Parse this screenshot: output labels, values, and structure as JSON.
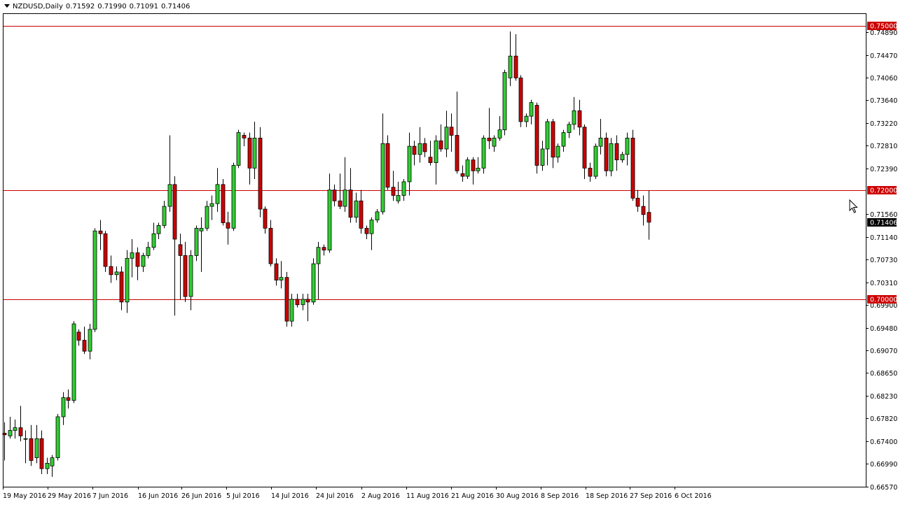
{
  "header": {
    "symbol": "NZDUSD,Daily",
    "open": "0.71592",
    "high": "0.71990",
    "low": "0.71091",
    "close": "0.71406"
  },
  "chart_data": {
    "type": "candlestick",
    "symbol": "NZDUSD",
    "timeframe": "Daily",
    "ylim": [
      0.6657,
      0.7522
    ],
    "y_ticks": [
      "0.74890",
      "0.74470",
      "0.74060",
      "0.73640",
      "0.73220",
      "0.72810",
      "0.72390",
      "0.71560",
      "0.71140",
      "0.70730",
      "0.70310",
      "0.69900",
      "0.69480",
      "0.69070",
      "0.68650",
      "0.68230",
      "0.67820",
      "0.67400",
      "0.66990",
      "0.66570"
    ],
    "x_labels": [
      "19 May 2016",
      "29 May 2016",
      "7 Jun 2016",
      "16 Jun 2016",
      "26 Jun 2016",
      "5 Jul 2016",
      "14 Jul 2016",
      "24 Jul 2016",
      "2 Aug 2016",
      "11 Aug 2016",
      "21 Aug 2016",
      "30 Aug 2016",
      "8 Sep 2016",
      "18 Sep 2016",
      "27 Sep 2016",
      "6 Oct 2016"
    ],
    "levels": [
      {
        "value": 0.75,
        "label": "0.75000"
      },
      {
        "value": 0.72,
        "label": "0.72000"
      },
      {
        "value": 0.7,
        "label": "0.70000"
      }
    ],
    "current_price": {
      "value": 0.71406,
      "label": "0.71406"
    },
    "colors": {
      "bull": "#32cd32",
      "bear": "#cc0000",
      "level": "#cc0000",
      "wick": "#000000"
    },
    "candles": [
      {
        "o": 0.6755,
        "h": 0.6775,
        "l": 0.6705,
        "c": 0.6752
      },
      {
        "o": 0.675,
        "h": 0.6785,
        "l": 0.6745,
        "c": 0.676
      },
      {
        "o": 0.676,
        "h": 0.678,
        "l": 0.6745,
        "c": 0.6765
      },
      {
        "o": 0.6765,
        "h": 0.6805,
        "l": 0.674,
        "c": 0.675
      },
      {
        "o": 0.6745,
        "h": 0.676,
        "l": 0.67,
        "c": 0.6745
      },
      {
        "o": 0.6745,
        "h": 0.677,
        "l": 0.6695,
        "c": 0.6705
      },
      {
        "o": 0.671,
        "h": 0.677,
        "l": 0.67,
        "c": 0.6745
      },
      {
        "o": 0.6745,
        "h": 0.676,
        "l": 0.668,
        "c": 0.669
      },
      {
        "o": 0.669,
        "h": 0.671,
        "l": 0.668,
        "c": 0.67
      },
      {
        "o": 0.6695,
        "h": 0.6715,
        "l": 0.6675,
        "c": 0.671
      },
      {
        "o": 0.671,
        "h": 0.679,
        "l": 0.6705,
        "c": 0.6785
      },
      {
        "o": 0.6785,
        "h": 0.683,
        "l": 0.677,
        "c": 0.682
      },
      {
        "o": 0.682,
        "h": 0.6835,
        "l": 0.68,
        "c": 0.6815
      },
      {
        "o": 0.6815,
        "h": 0.696,
        "l": 0.681,
        "c": 0.6955
      },
      {
        "o": 0.694,
        "h": 0.6945,
        "l": 0.6915,
        "c": 0.6925
      },
      {
        "o": 0.6925,
        "h": 0.695,
        "l": 0.69,
        "c": 0.6905
      },
      {
        "o": 0.6905,
        "h": 0.6955,
        "l": 0.689,
        "c": 0.6945
      },
      {
        "o": 0.6945,
        "h": 0.713,
        "l": 0.694,
        "c": 0.7125
      },
      {
        "o": 0.7125,
        "h": 0.7145,
        "l": 0.709,
        "c": 0.712
      },
      {
        "o": 0.712,
        "h": 0.7125,
        "l": 0.705,
        "c": 0.706
      },
      {
        "o": 0.706,
        "h": 0.708,
        "l": 0.703,
        "c": 0.7045
      },
      {
        "o": 0.7045,
        "h": 0.706,
        "l": 0.7035,
        "c": 0.705
      },
      {
        "o": 0.705,
        "h": 0.706,
        "l": 0.698,
        "c": 0.6995
      },
      {
        "o": 0.6995,
        "h": 0.709,
        "l": 0.6975,
        "c": 0.7075
      },
      {
        "o": 0.7075,
        "h": 0.711,
        "l": 0.704,
        "c": 0.7085
      },
      {
        "o": 0.7085,
        "h": 0.7095,
        "l": 0.7035,
        "c": 0.706
      },
      {
        "o": 0.706,
        "h": 0.7085,
        "l": 0.705,
        "c": 0.708
      },
      {
        "o": 0.708,
        "h": 0.7105,
        "l": 0.7075,
        "c": 0.7095
      },
      {
        "o": 0.7095,
        "h": 0.714,
        "l": 0.709,
        "c": 0.712
      },
      {
        "o": 0.712,
        "h": 0.714,
        "l": 0.711,
        "c": 0.7135
      },
      {
        "o": 0.7135,
        "h": 0.718,
        "l": 0.713,
        "c": 0.717
      },
      {
        "o": 0.717,
        "h": 0.73,
        "l": 0.716,
        "c": 0.721
      },
      {
        "o": 0.721,
        "h": 0.7225,
        "l": 0.697,
        "c": 0.711
      },
      {
        "o": 0.71,
        "h": 0.712,
        "l": 0.7,
        "c": 0.708
      },
      {
        "o": 0.708,
        "h": 0.7105,
        "l": 0.6995,
        "c": 0.7005
      },
      {
        "o": 0.7005,
        "h": 0.709,
        "l": 0.698,
        "c": 0.708
      },
      {
        "o": 0.708,
        "h": 0.7135,
        "l": 0.707,
        "c": 0.713
      },
      {
        "o": 0.7125,
        "h": 0.715,
        "l": 0.705,
        "c": 0.713
      },
      {
        "o": 0.713,
        "h": 0.718,
        "l": 0.7125,
        "c": 0.717
      },
      {
        "o": 0.717,
        "h": 0.719,
        "l": 0.7145,
        "c": 0.7175
      },
      {
        "o": 0.7175,
        "h": 0.724,
        "l": 0.716,
        "c": 0.721
      },
      {
        "o": 0.721,
        "h": 0.722,
        "l": 0.7135,
        "c": 0.714
      },
      {
        "o": 0.714,
        "h": 0.716,
        "l": 0.71,
        "c": 0.713
      },
      {
        "o": 0.713,
        "h": 0.725,
        "l": 0.7125,
        "c": 0.7245
      },
      {
        "o": 0.7245,
        "h": 0.731,
        "l": 0.724,
        "c": 0.7305
      },
      {
        "o": 0.73,
        "h": 0.7305,
        "l": 0.728,
        "c": 0.7295
      },
      {
        "o": 0.7295,
        "h": 0.7305,
        "l": 0.721,
        "c": 0.724
      },
      {
        "o": 0.724,
        "h": 0.7325,
        "l": 0.722,
        "c": 0.7295
      },
      {
        "o": 0.7295,
        "h": 0.7315,
        "l": 0.715,
        "c": 0.7165
      },
      {
        "o": 0.7165,
        "h": 0.717,
        "l": 0.712,
        "c": 0.713
      },
      {
        "o": 0.713,
        "h": 0.7145,
        "l": 0.706,
        "c": 0.7065
      },
      {
        "o": 0.7065,
        "h": 0.7075,
        "l": 0.7025,
        "c": 0.7035
      },
      {
        "o": 0.7035,
        "h": 0.707,
        "l": 0.702,
        "c": 0.704
      },
      {
        "o": 0.704,
        "h": 0.705,
        "l": 0.695,
        "c": 0.696
      },
      {
        "o": 0.696,
        "h": 0.701,
        "l": 0.695,
        "c": 0.7
      },
      {
        "o": 0.7,
        "h": 0.701,
        "l": 0.6985,
        "c": 0.699
      },
      {
        "o": 0.699,
        "h": 0.701,
        "l": 0.698,
        "c": 0.7
      },
      {
        "o": 0.7,
        "h": 0.701,
        "l": 0.696,
        "c": 0.6995
      },
      {
        "o": 0.6995,
        "h": 0.7075,
        "l": 0.699,
        "c": 0.7065
      },
      {
        "o": 0.7065,
        "h": 0.7105,
        "l": 0.7,
        "c": 0.7095
      },
      {
        "o": 0.7095,
        "h": 0.71,
        "l": 0.708,
        "c": 0.709
      },
      {
        "o": 0.709,
        "h": 0.723,
        "l": 0.7085,
        "c": 0.72
      },
      {
        "o": 0.72,
        "h": 0.721,
        "l": 0.717,
        "c": 0.718
      },
      {
        "o": 0.718,
        "h": 0.723,
        "l": 0.7165,
        "c": 0.717
      },
      {
        "o": 0.717,
        "h": 0.726,
        "l": 0.716,
        "c": 0.72
      },
      {
        "o": 0.72,
        "h": 0.724,
        "l": 0.714,
        "c": 0.715
      },
      {
        "o": 0.715,
        "h": 0.7195,
        "l": 0.714,
        "c": 0.718
      },
      {
        "o": 0.718,
        "h": 0.72,
        "l": 0.712,
        "c": 0.713
      },
      {
        "o": 0.713,
        "h": 0.7135,
        "l": 0.711,
        "c": 0.712
      },
      {
        "o": 0.712,
        "h": 0.715,
        "l": 0.709,
        "c": 0.7145
      },
      {
        "o": 0.7145,
        "h": 0.7165,
        "l": 0.714,
        "c": 0.716
      },
      {
        "o": 0.716,
        "h": 0.734,
        "l": 0.7155,
        "c": 0.7285
      },
      {
        "o": 0.7285,
        "h": 0.73,
        "l": 0.72,
        "c": 0.7205
      },
      {
        "o": 0.7205,
        "h": 0.7235,
        "l": 0.718,
        "c": 0.719
      },
      {
        "o": 0.718,
        "h": 0.7215,
        "l": 0.7175,
        "c": 0.719
      },
      {
        "o": 0.719,
        "h": 0.722,
        "l": 0.718,
        "c": 0.7215
      },
      {
        "o": 0.7215,
        "h": 0.7305,
        "l": 0.719,
        "c": 0.728
      },
      {
        "o": 0.728,
        "h": 0.729,
        "l": 0.7245,
        "c": 0.7265
      },
      {
        "o": 0.7265,
        "h": 0.7315,
        "l": 0.725,
        "c": 0.7285
      },
      {
        "o": 0.7285,
        "h": 0.7295,
        "l": 0.726,
        "c": 0.727
      },
      {
        "o": 0.726,
        "h": 0.729,
        "l": 0.7245,
        "c": 0.725
      },
      {
        "o": 0.725,
        "h": 0.73,
        "l": 0.721,
        "c": 0.729
      },
      {
        "o": 0.729,
        "h": 0.732,
        "l": 0.727,
        "c": 0.7275
      },
      {
        "o": 0.7275,
        "h": 0.7345,
        "l": 0.726,
        "c": 0.7315
      },
      {
        "o": 0.7315,
        "h": 0.734,
        "l": 0.727,
        "c": 0.73
      },
      {
        "o": 0.73,
        "h": 0.738,
        "l": 0.723,
        "c": 0.7235
      },
      {
        "o": 0.723,
        "h": 0.7245,
        "l": 0.7215,
        "c": 0.7225
      },
      {
        "o": 0.7225,
        "h": 0.726,
        "l": 0.722,
        "c": 0.7255
      },
      {
        "o": 0.7255,
        "h": 0.726,
        "l": 0.721,
        "c": 0.7235
      },
      {
        "o": 0.7235,
        "h": 0.726,
        "l": 0.723,
        "c": 0.724
      },
      {
        "o": 0.724,
        "h": 0.73,
        "l": 0.723,
        "c": 0.7295
      },
      {
        "o": 0.7295,
        "h": 0.735,
        "l": 0.7275,
        "c": 0.729
      },
      {
        "o": 0.728,
        "h": 0.73,
        "l": 0.727,
        "c": 0.7295
      },
      {
        "o": 0.7295,
        "h": 0.7335,
        "l": 0.729,
        "c": 0.731
      },
      {
        "o": 0.731,
        "h": 0.742,
        "l": 0.73,
        "c": 0.7415
      },
      {
        "o": 0.7405,
        "h": 0.749,
        "l": 0.739,
        "c": 0.7445
      },
      {
        "o": 0.7445,
        "h": 0.7485,
        "l": 0.74,
        "c": 0.7405
      },
      {
        "o": 0.7405,
        "h": 0.741,
        "l": 0.7315,
        "c": 0.7325
      },
      {
        "o": 0.7325,
        "h": 0.734,
        "l": 0.7315,
        "c": 0.7335
      },
      {
        "o": 0.7335,
        "h": 0.7365,
        "l": 0.732,
        "c": 0.736
      },
      {
        "o": 0.7355,
        "h": 0.736,
        "l": 0.723,
        "c": 0.7245
      },
      {
        "o": 0.7245,
        "h": 0.729,
        "l": 0.7235,
        "c": 0.7275
      },
      {
        "o": 0.7275,
        "h": 0.733,
        "l": 0.7245,
        "c": 0.7325
      },
      {
        "o": 0.7325,
        "h": 0.733,
        "l": 0.724,
        "c": 0.726
      },
      {
        "o": 0.726,
        "h": 0.7285,
        "l": 0.725,
        "c": 0.728
      },
      {
        "o": 0.728,
        "h": 0.731,
        "l": 0.727,
        "c": 0.7305
      },
      {
        "o": 0.7305,
        "h": 0.7325,
        "l": 0.7295,
        "c": 0.732
      },
      {
        "o": 0.732,
        "h": 0.737,
        "l": 0.731,
        "c": 0.7345
      },
      {
        "o": 0.7345,
        "h": 0.7365,
        "l": 0.73,
        "c": 0.7315
      },
      {
        "o": 0.7315,
        "h": 0.732,
        "l": 0.722,
        "c": 0.724
      },
      {
        "o": 0.724,
        "h": 0.725,
        "l": 0.7215,
        "c": 0.7225
      },
      {
        "o": 0.7225,
        "h": 0.7285,
        "l": 0.722,
        "c": 0.728
      },
      {
        "o": 0.728,
        "h": 0.733,
        "l": 0.7265,
        "c": 0.7295
      },
      {
        "o": 0.7295,
        "h": 0.7305,
        "l": 0.7225,
        "c": 0.7235
      },
      {
        "o": 0.7235,
        "h": 0.7295,
        "l": 0.7225,
        "c": 0.7285
      },
      {
        "o": 0.7285,
        "h": 0.73,
        "l": 0.7235,
        "c": 0.7255
      },
      {
        "o": 0.7255,
        "h": 0.727,
        "l": 0.725,
        "c": 0.7265
      },
      {
        "o": 0.7265,
        "h": 0.7305,
        "l": 0.7245,
        "c": 0.7295
      },
      {
        "o": 0.7295,
        "h": 0.731,
        "l": 0.718,
        "c": 0.7185
      },
      {
        "o": 0.7185,
        "h": 0.72,
        "l": 0.716,
        "c": 0.717
      },
      {
        "o": 0.717,
        "h": 0.719,
        "l": 0.7135,
        "c": 0.7155
      },
      {
        "o": 0.7159,
        "h": 0.7199,
        "l": 0.7109,
        "c": 0.7141
      }
    ]
  }
}
